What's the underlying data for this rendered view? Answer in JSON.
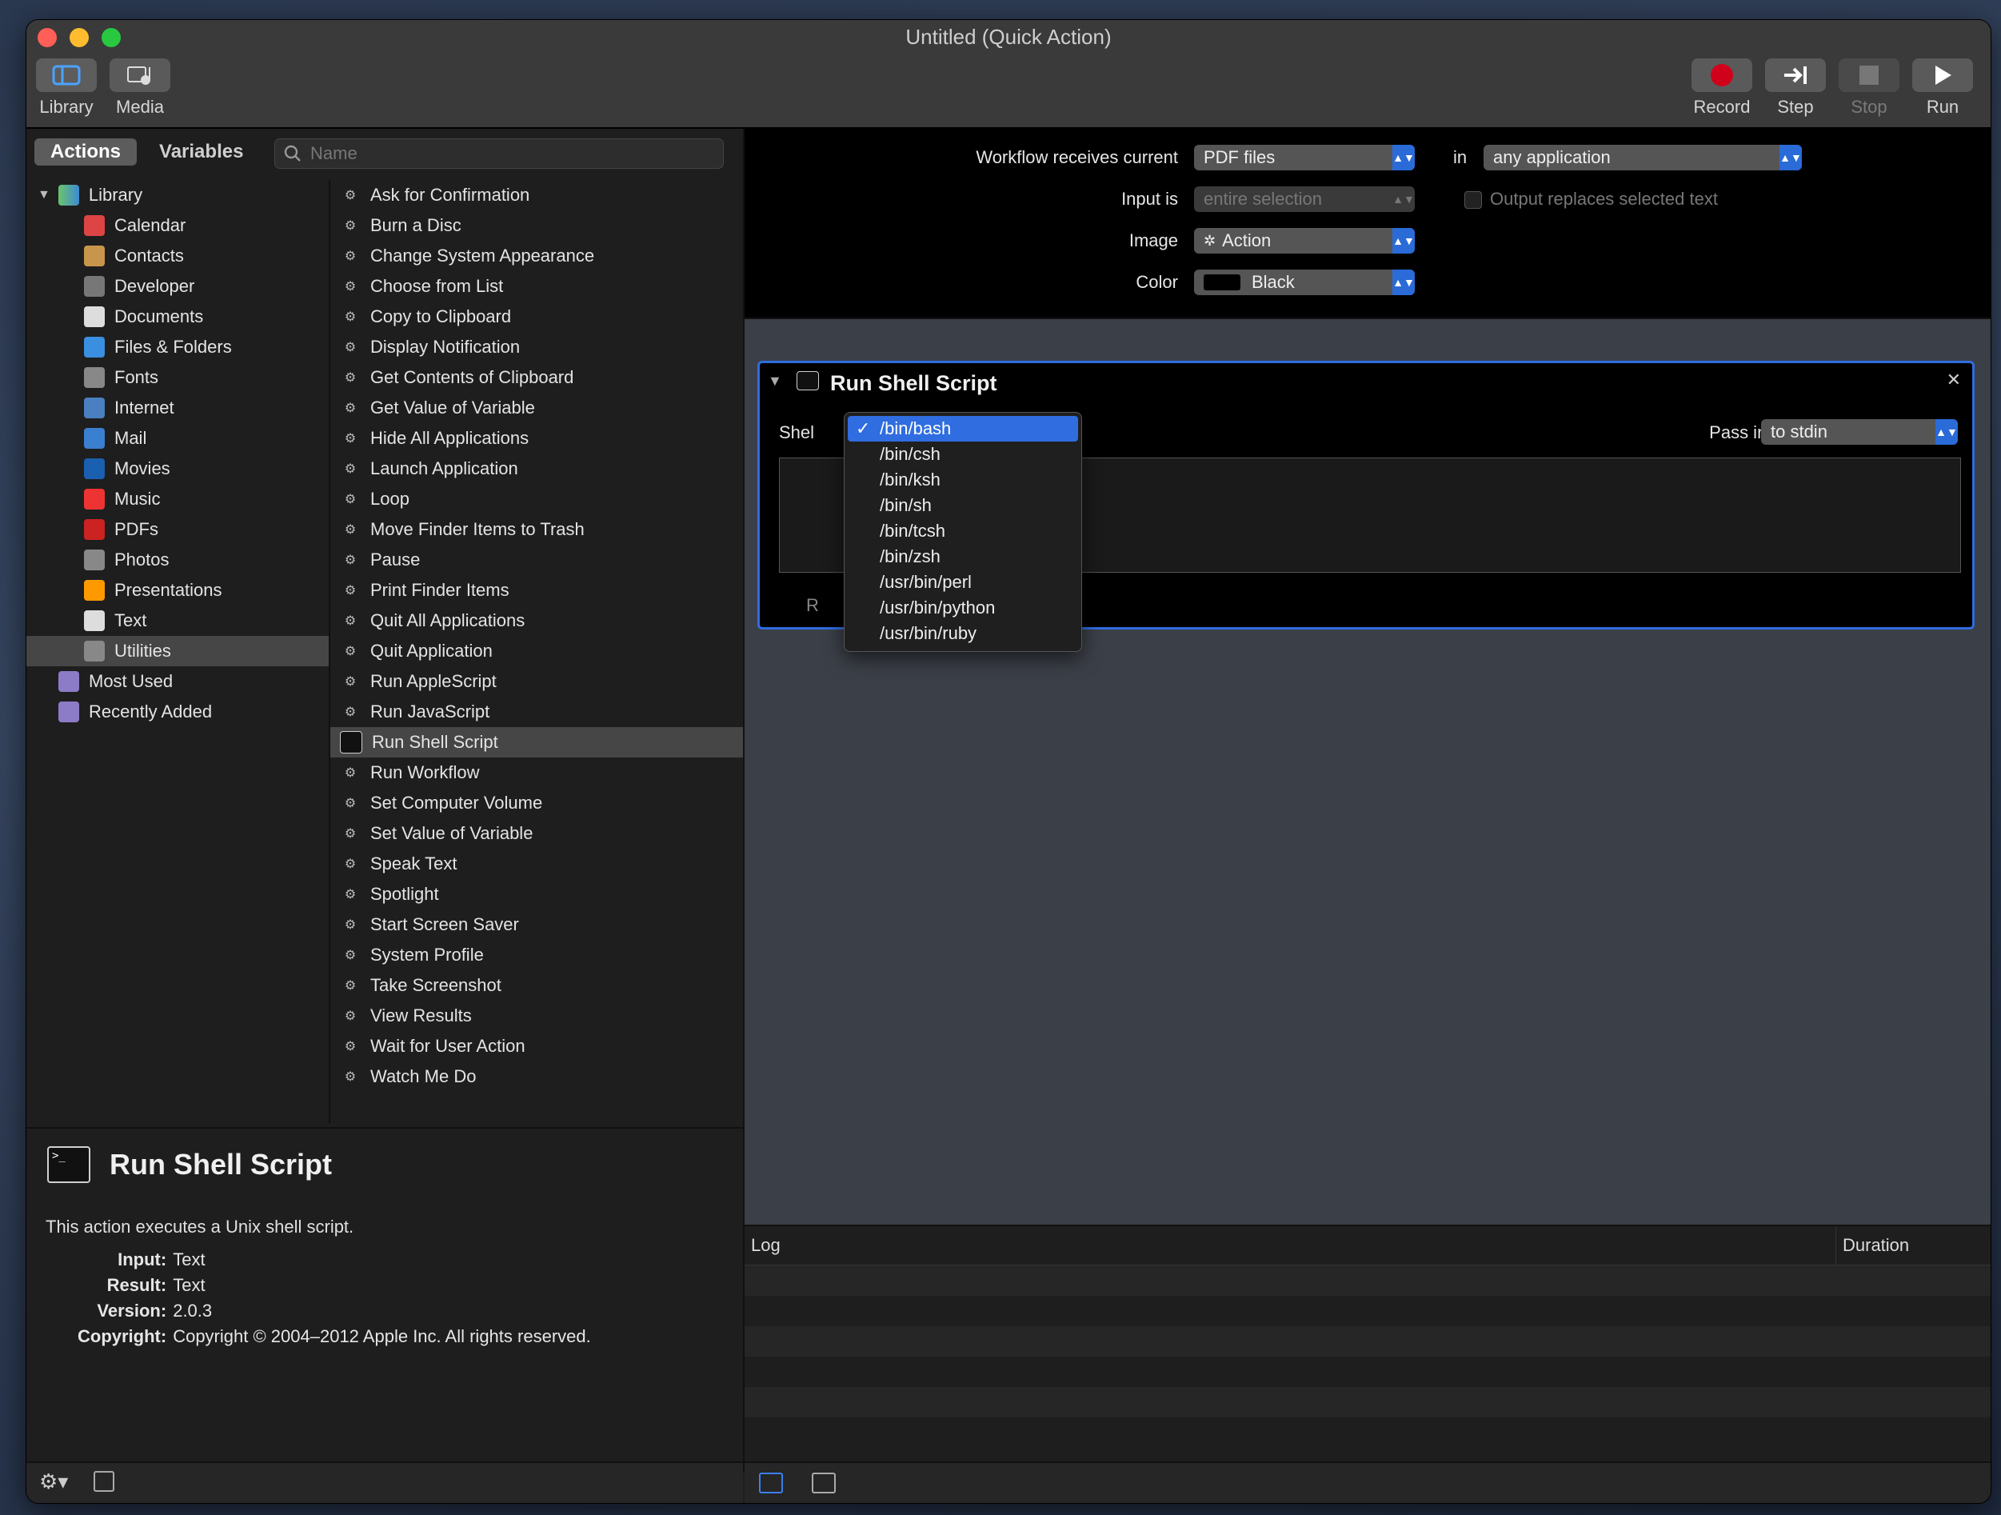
{
  "window": {
    "title": "Untitled (Quick Action)"
  },
  "toolbar": {
    "library": "Library",
    "media": "Media",
    "record": "Record",
    "step": "Step",
    "stop": "Stop",
    "run": "Run"
  },
  "left": {
    "tabs": [
      "Actions",
      "Variables"
    ],
    "search_placeholder": "Name",
    "library_root": "Library",
    "categories": [
      "Calendar",
      "Contacts",
      "Developer",
      "Documents",
      "Files & Folders",
      "Fonts",
      "Internet",
      "Mail",
      "Movies",
      "Music",
      "PDFs",
      "Photos",
      "Presentations",
      "Text",
      "Utilities"
    ],
    "collections": [
      "Most Used",
      "Recently Added"
    ],
    "actions": [
      "Ask for Confirmation",
      "Burn a Disc",
      "Change System Appearance",
      "Choose from List",
      "Copy to Clipboard",
      "Display Notification",
      "Get Contents of Clipboard",
      "Get Value of Variable",
      "Hide All Applications",
      "Launch Application",
      "Loop",
      "Move Finder Items to Trash",
      "Pause",
      "Print Finder Items",
      "Quit All Applications",
      "Quit Application",
      "Run AppleScript",
      "Run JavaScript",
      "Run Shell Script",
      "Run Workflow",
      "Set Computer Volume",
      "Set Value of Variable",
      "Speak Text",
      "Spotlight",
      "Start Screen Saver",
      "System Profile",
      "Take Screenshot",
      "View Results",
      "Wait for User Action",
      "Watch Me Do"
    ]
  },
  "description": {
    "title": "Run Shell Script",
    "summary": "This action executes a Unix shell script.",
    "input_key": "Input:",
    "input": "Text",
    "result_key": "Result:",
    "result": "Text",
    "version_key": "Version:",
    "version": "2.0.3",
    "copyright_key": "Copyright:",
    "copyright": "Copyright © 2004–2012 Apple Inc.  All rights reserved."
  },
  "workflow": {
    "receives_label": "Workflow receives current",
    "receives_value": "PDF files",
    "in_label": "in",
    "app_value": "any application",
    "input_is_label": "Input is",
    "input_is_value": "entire selection",
    "output_replaces": "Output replaces selected text",
    "image_label": "Image",
    "image_value": "Action",
    "color_label": "Color",
    "color_value": "Black"
  },
  "action": {
    "title": "Run Shell Script",
    "shell_label": "Shel",
    "pass_input_label": "Pass input:",
    "pass_input_value": "to stdin",
    "results_fragment": "R",
    "shell_options": [
      "/bin/bash",
      "/bin/csh",
      "/bin/ksh",
      "/bin/sh",
      "/bin/tcsh",
      "/bin/zsh",
      "/usr/bin/perl",
      "/usr/bin/python",
      "/usr/bin/ruby"
    ],
    "selected_shell": "/bin/bash",
    "check": "✓"
  },
  "log": {
    "log_header": "Log",
    "duration_header": "Duration"
  },
  "colors": {
    "accent": "#2f6de0",
    "record": "#d0021b"
  }
}
